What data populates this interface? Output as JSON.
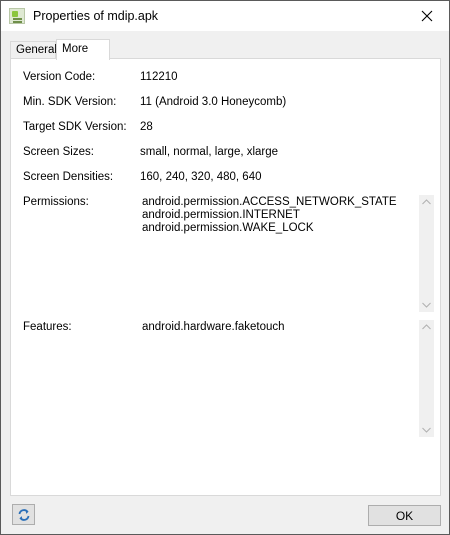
{
  "window": {
    "title": "Properties of mdip.apk"
  },
  "tabs": [
    {
      "label": "General"
    },
    {
      "label": "More"
    }
  ],
  "fields": {
    "version_code": {
      "label": "Version Code:",
      "value": "112210"
    },
    "min_sdk": {
      "label": "Min. SDK Version:",
      "value": "11 (Android 3.0 Honeycomb)"
    },
    "target_sdk": {
      "label": "Target SDK Version:",
      "value": "28"
    },
    "screen_sizes": {
      "label": "Screen Sizes:",
      "value": "small, normal, large, xlarge"
    },
    "screen_densities": {
      "label": "Screen Densities:",
      "value": "160, 240, 320, 480, 640"
    }
  },
  "permissions": {
    "label": "Permissions:",
    "items": [
      "android.permission.ACCESS_NETWORK_STATE",
      "android.permission.INTERNET",
      "android.permission.WAKE_LOCK"
    ]
  },
  "features": {
    "label": "Features:",
    "items": [
      "android.hardware.faketouch"
    ]
  },
  "buttons": {
    "ok": "OK"
  },
  "icons": {
    "app": "apk-file-icon",
    "close": "close-icon",
    "refresh": "refresh-icon",
    "scroll_up": "chevron-up-icon",
    "scroll_down": "chevron-down-icon"
  },
  "colors": {
    "refresh_icon": "#2a6fb8",
    "border": "#d9d9d9"
  }
}
